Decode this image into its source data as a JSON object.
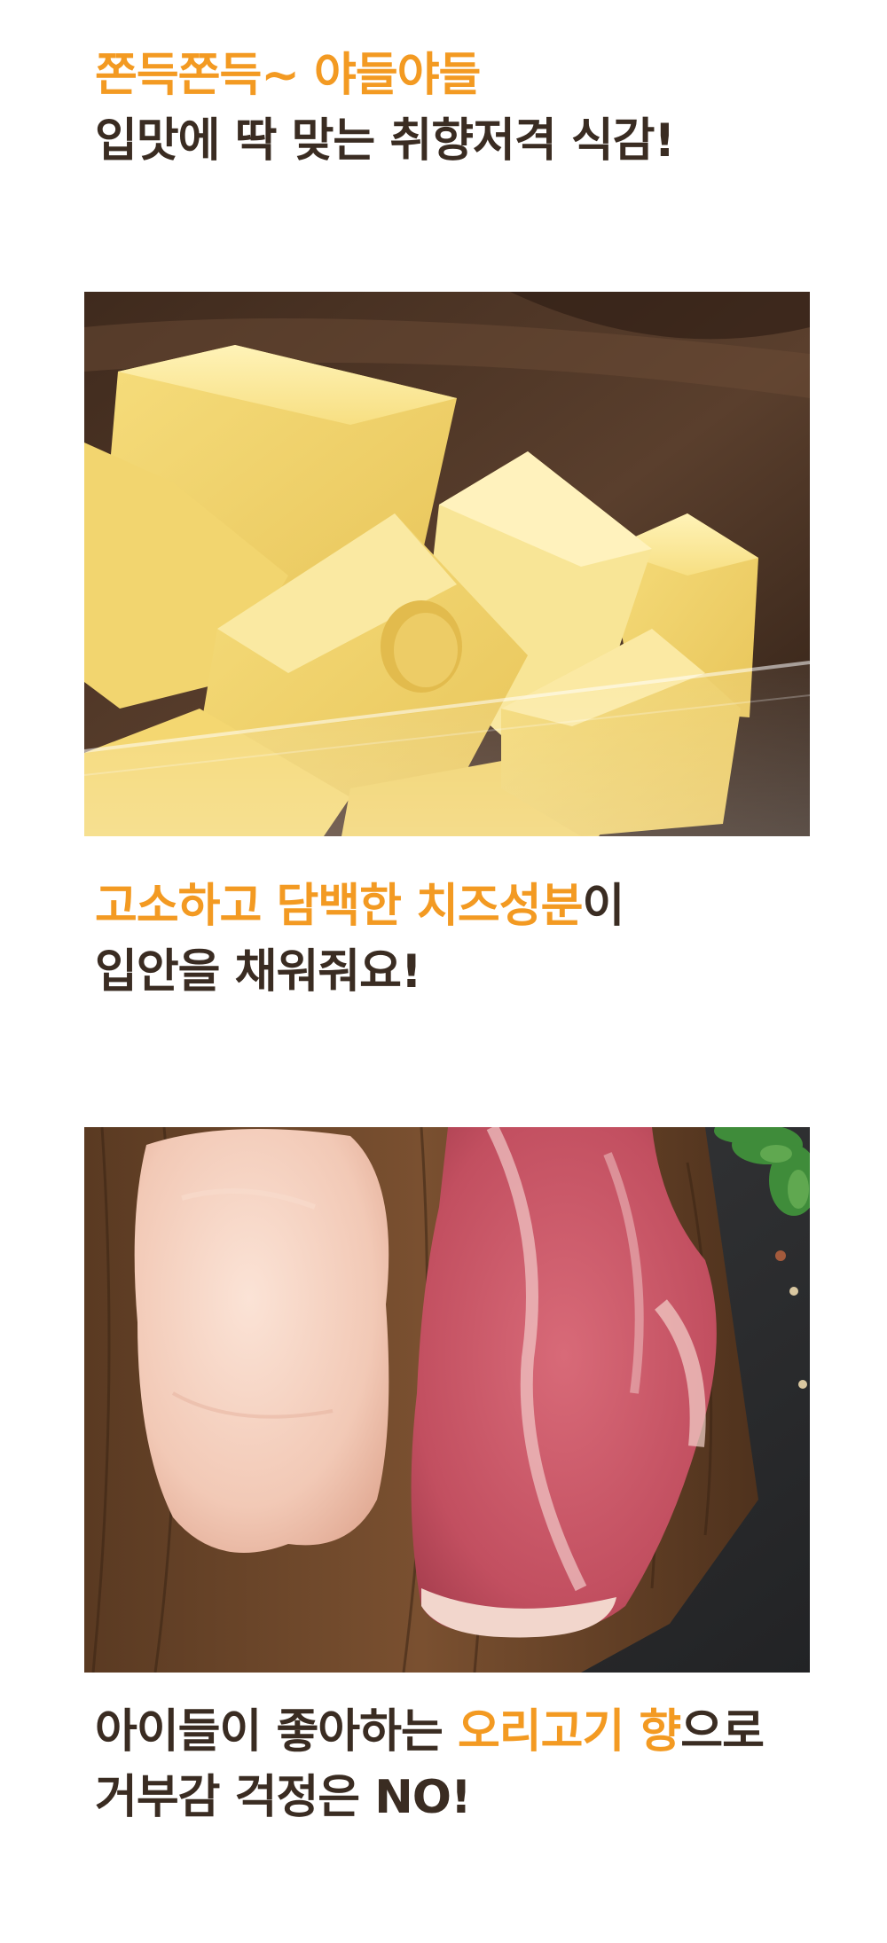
{
  "section1": {
    "line1": "쫀득쫀득~ 야들야들",
    "line2": "입맛에 딱 맞는 취향저격 식감!"
  },
  "section2": {
    "line1_highlight": "고소하고 담백한 치즈성분",
    "line1_rest": "이",
    "line2": "입안을 채워줘요!"
  },
  "section3": {
    "line1_pre": "아이들이 좋아하는 ",
    "line1_highlight": "오리고기 향",
    "line1_post": "으로",
    "line2": "거부감 걱정은 NO!"
  },
  "colors": {
    "accent": "#f39a22",
    "text": "#3a2c22"
  }
}
